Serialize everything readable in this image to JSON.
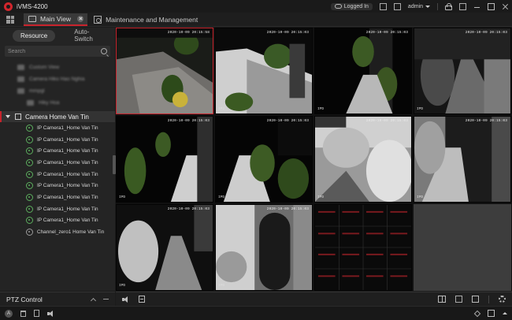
{
  "app": {
    "title": "iVMS-4200"
  },
  "titlebar": {
    "logged_in": "Logged In",
    "user": "admin"
  },
  "tabs": [
    {
      "label": "Main View",
      "active": true
    },
    {
      "label": "Maintenance and Management",
      "active": false
    }
  ],
  "resource_panel": {
    "tabs": [
      "Resource",
      "Auto-Switch"
    ],
    "search_placeholder": "Search",
    "blurred_items": [
      "Custom View",
      "Camera Hiko Hao Nghia",
      "mmpgl",
      "Hiky Hoa"
    ],
    "group": "Camera Home Van Tin",
    "cameras": [
      "IP Camera1_Home Van Tin",
      "IP Camera1_Home Van Tin",
      "IP Camera1_Home Van Tin",
      "IP Camera1_Home Van Tin",
      "IP Camera1_Home Van Tin",
      "IP Camera1_Home Van Tin",
      "IP Camera1_Home Van Tin",
      "IP Camera1_Home Van Tin",
      "IP Camera1_Home Van Tin"
    ],
    "channel": "Channel_zero1 Home Van Tin"
  },
  "ptz": {
    "label": "PTZ Control"
  },
  "video": {
    "timestamps": [
      "2020-10-09 20:15:58",
      "2020-10-09 20:15:03",
      "2020-10-09 20:15:03",
      "2020-10-09 20:15:03",
      "2020-10-09 20:15:03",
      "2020-10-09 20:15:03",
      "2020-10-09 20:15:03",
      "2020-10-09 20:15:03",
      "2020-10-09 20:15:03",
      "2020-10-09 20:15:03"
    ],
    "channel_labels": [
      "",
      "IP2",
      "IPD",
      "IPD",
      "IPD",
      "IPD",
      "IPD",
      "IPD",
      "IPD",
      "IPD"
    ]
  },
  "colors": {
    "accent": "#c8232c",
    "online": "#5cae5e"
  },
  "icons": [
    "grid-icon",
    "cloud-icon",
    "lock-icon",
    "speaker-icon",
    "record-icon",
    "layout-icon",
    "fullscreen-icon",
    "gear-icon"
  ]
}
